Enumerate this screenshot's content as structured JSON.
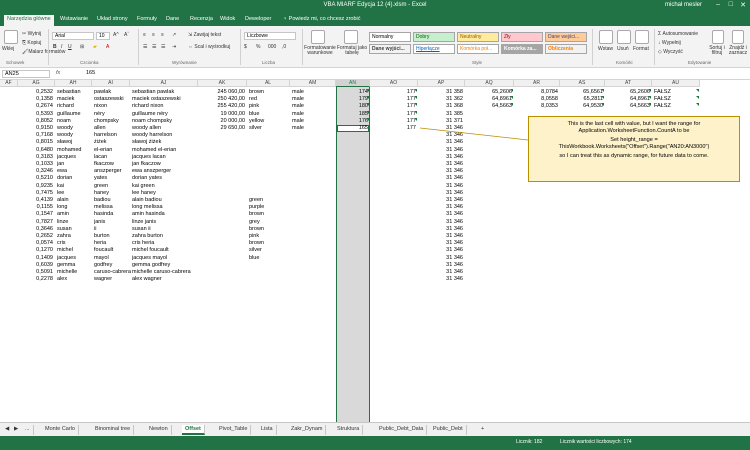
{
  "window": {
    "title": "VBA MIARF Edycja 12 (4).xlsm - Excel",
    "user": "michał mesler"
  },
  "ribbon_tabs": [
    "Narzędzia główne",
    "Wstawianie",
    "Układ strony",
    "Formuły",
    "Dane",
    "Recenzja",
    "Widok",
    "Deweloper"
  ],
  "tell_me": "Powiedz mi, co chcesz zrobić",
  "clipboard": {
    "cut": "Wytnij",
    "copy": "Kopiuj",
    "painter": "Malarz formatów",
    "paste": "Wklej",
    "group": "Schowek"
  },
  "font": {
    "name": "Arial",
    "size": "10",
    "group": "Czcionka"
  },
  "alignment": {
    "wrap": "Zawijaj tekst",
    "merge": "Scal i wyśrodkuj",
    "group": "Wyrównanie"
  },
  "number": {
    "format": "Liczbowe",
    "group": "Liczba"
  },
  "cond_format": "Formatowanie warunkowe",
  "format_table": "Formatuj jako tabelę",
  "styles": {
    "normal": "Normalny",
    "good": "Dobry",
    "neutral": "Neutralny",
    "bad": "Zły",
    "input": "Dane wejści...",
    "hyperlink": "Hiperłącze",
    "linked": "Komórka poł...",
    "check": "Komórka za...",
    "calculation": "Obliczenia",
    "output": "Dane wyjści...",
    "group": "Style"
  },
  "cells": {
    "insert": "Wstaw",
    "delete": "Usuń",
    "format": "Format",
    "group": "Komórki"
  },
  "editing": {
    "autosum": "Autosumowanie",
    "fill": "Wypełnij",
    "clear": "Wyczyść",
    "sort": "Sortuj i filtruj",
    "find": "Znajdź i zaznacz",
    "group": "Edytowanie"
  },
  "formula_bar": {
    "name_box": "AN25",
    "fx": "fx",
    "value": "165"
  },
  "columns": [
    "AF",
    "AG",
    "AH",
    "AI",
    "AJ",
    "AK",
    "AL",
    "AM",
    "AN",
    "AO",
    "AP",
    "AQ",
    "AR",
    "AS",
    "AT",
    "AU"
  ],
  "rows": [
    {
      "ag": "0,2532",
      "ah": "sebastian",
      "ai": "pawlak",
      "aj": "sebastian pawlak",
      "ak": "245 060,00",
      "al": "brown",
      "am": "male",
      "an": "174",
      "ao": "177",
      "ap": "31 358",
      "aq": "65,2606",
      "ar": "8,0784",
      "as": "65,6561",
      "at": "65,2606",
      "au": "FAŁSZ"
    },
    {
      "ag": "0,1358",
      "ah": "maciek",
      "ai": "ostaszewski",
      "aj": "maciek ostaszewski",
      "ak": "250 420,00",
      "al": "red",
      "am": "male",
      "an": "179",
      "ao": "177",
      "ap": "31 362",
      "aq": "64,8961",
      "ar": "8,0558",
      "as": "65,2811",
      "at": "64,8961",
      "au": "FAŁSZ"
    },
    {
      "ag": "0,2674",
      "ah": "richard",
      "ai": "nixon",
      "aj": "richard nixon",
      "ak": "255 420,00",
      "al": "pink",
      "am": "male",
      "an": "180",
      "ao": "177",
      "ap": "31 368",
      "aq": "64,5663",
      "ar": "8,0353",
      "as": "64,9530",
      "at": "64,5663",
      "au": "FAŁSZ"
    },
    {
      "ag": "0,5393",
      "ah": "guillaume",
      "ai": "néry",
      "aj": "guillaume néry",
      "ak": "19 000,00",
      "al": "blue",
      "am": "male",
      "an": "185",
      "ao": "177",
      "ap": "31 385",
      "aq": "",
      "ar": "",
      "as": "",
      "at": "",
      "au": ""
    },
    {
      "ag": "0,8052",
      "ah": "noam",
      "ai": "chompsky",
      "aj": "noam chompsky",
      "ak": "20 000,00",
      "al": "yellow",
      "am": "male",
      "an": "176",
      "ao": "177",
      "ap": "31 371",
      "aq": "",
      "ar": "",
      "as": "",
      "at": "",
      "au": ""
    },
    {
      "ag": "0,9150",
      "ah": "woody",
      "ai": "allen",
      "aj": "woody allen",
      "ak": "29 650,00",
      "al": "silver",
      "am": "male",
      "an": "165",
      "ao": "177",
      "ap": "31 346",
      "aq": "",
      "ar": "",
      "as": "",
      "at": "",
      "au": ""
    },
    {
      "ag": "0,7168",
      "ah": "woody",
      "ai": "harrelson",
      "aj": "woody harrelson",
      "ak": "",
      "al": "",
      "am": "",
      "an": "",
      "ao": "",
      "ap": "31 346",
      "aq": "",
      "ar": "",
      "as": "",
      "at": "",
      "au": ""
    },
    {
      "ag": "0,8015",
      "ah": "sławoj",
      "ai": "żiżek",
      "aj": "sławoj żiżek",
      "ak": "",
      "al": "",
      "am": "",
      "an": "",
      "ao": "",
      "ap": "31 346",
      "aq": "",
      "ar": "",
      "as": "",
      "at": "",
      "au": ""
    },
    {
      "ag": "0,6480",
      "ah": "mohamed",
      "ai": "el-erian",
      "aj": "mohamed el-erian",
      "ak": "",
      "al": "",
      "am": "",
      "an": "",
      "ao": "",
      "ap": "31 346",
      "aq": "",
      "ar": "",
      "as": "",
      "at": "",
      "au": ""
    },
    {
      "ag": "0,3183",
      "ah": "jacques",
      "ai": "lacan",
      "aj": "jacques lacan",
      "ak": "",
      "al": "",
      "am": "",
      "an": "",
      "ao": "",
      "ap": "31 346",
      "aq": "",
      "ar": "",
      "as": "",
      "at": "",
      "au": ""
    },
    {
      "ag": "0,1033",
      "ah": "jan",
      "ai": "fkaczow",
      "aj": "jan fkaczow",
      "ak": "",
      "al": "",
      "am": "",
      "an": "",
      "ao": "",
      "ap": "31 346",
      "aq": "",
      "ar": "",
      "as": "",
      "at": "",
      "au": ""
    },
    {
      "ag": "0,3246",
      "ah": "ewa",
      "ai": "anszperger",
      "aj": "ewa anszperger",
      "ak": "",
      "al": "",
      "am": "",
      "an": "",
      "ao": "",
      "ap": "31 346",
      "aq": "",
      "ar": "",
      "as": "",
      "at": "",
      "au": ""
    },
    {
      "ag": "0,5210",
      "ah": "dorian",
      "ai": "yates",
      "aj": "dorian yates",
      "ak": "",
      "al": "",
      "am": "",
      "an": "",
      "ao": "",
      "ap": "31 346",
      "aq": "",
      "ar": "",
      "as": "",
      "at": "",
      "au": ""
    },
    {
      "ag": "0,9235",
      "ah": "kai",
      "ai": "green",
      "aj": "kai green",
      "ak": "",
      "al": "",
      "am": "",
      "an": "",
      "ao": "",
      "ap": "31 346",
      "aq": "",
      "ar": "",
      "as": "",
      "at": "",
      "au": ""
    },
    {
      "ag": "0,7475",
      "ah": "lee",
      "ai": "haney",
      "aj": "lee haney",
      "ak": "",
      "al": "",
      "am": "",
      "an": "",
      "ao": "",
      "ap": "31 346",
      "aq": "",
      "ar": "",
      "as": "",
      "at": "",
      "au": ""
    },
    {
      "ag": "0,4139",
      "ah": "alain",
      "ai": "badiou",
      "aj": "alain badiou",
      "ak": "",
      "al": "green",
      "am": "",
      "an": "",
      "ao": "",
      "ap": "31 346",
      "aq": "",
      "ar": "",
      "as": "",
      "at": "",
      "au": ""
    },
    {
      "ag": "0,1155",
      "ah": "long",
      "ai": "melissa",
      "aj": "long melissa",
      "ak": "",
      "al": "purple",
      "am": "",
      "an": "",
      "ao": "",
      "ap": "31 346",
      "aq": "",
      "ar": "",
      "as": "",
      "at": "",
      "au": ""
    },
    {
      "ag": "0,1547",
      "ah": "amin",
      "ai": "hasinda",
      "aj": "amin hasinda",
      "ak": "",
      "al": "brown",
      "am": "",
      "an": "",
      "ao": "",
      "ap": "31 346",
      "aq": "",
      "ar": "",
      "as": "",
      "at": "",
      "au": ""
    },
    {
      "ag": "0,7827",
      "ah": "linze",
      "ai": "janis",
      "aj": "linze janis",
      "ak": "",
      "al": "grey",
      "am": "",
      "an": "",
      "ao": "",
      "ap": "31 346",
      "aq": "",
      "ar": "",
      "as": "",
      "at": "",
      "au": ""
    },
    {
      "ag": "0,3646",
      "ah": "susan",
      "ai": "ii",
      "aj": "susan ii",
      "ak": "",
      "al": "brown",
      "am": "",
      "an": "",
      "ao": "",
      "ap": "31 346",
      "aq": "",
      "ar": "",
      "as": "",
      "at": "",
      "au": ""
    },
    {
      "ag": "0,2652",
      "ah": "zahra",
      "ai": "burton",
      "aj": "zahra burton",
      "ak": "",
      "al": "pink",
      "am": "",
      "an": "",
      "ao": "",
      "ap": "31 346",
      "aq": "",
      "ar": "",
      "as": "",
      "at": "",
      "au": ""
    },
    {
      "ag": "0,0574",
      "ah": "cris",
      "ai": "heria",
      "aj": "cris heria",
      "ak": "",
      "al": "brown",
      "am": "",
      "an": "",
      "ao": "",
      "ap": "31 346",
      "aq": "",
      "ar": "",
      "as": "",
      "at": "",
      "au": ""
    },
    {
      "ag": "0,1270",
      "ah": "michel",
      "ai": "foucault",
      "aj": "michel foucault",
      "ak": "",
      "al": "silver",
      "am": "",
      "an": "",
      "ao": "",
      "ap": "31 346",
      "aq": "",
      "ar": "",
      "as": "",
      "at": "",
      "au": ""
    },
    {
      "ag": "0,1409",
      "ah": "jacques",
      "ai": "mayol",
      "aj": "jacques mayol",
      "ak": "",
      "al": "blue",
      "am": "",
      "an": "",
      "ao": "",
      "ap": "31 346",
      "aq": "",
      "ar": "",
      "as": "",
      "at": "",
      "au": ""
    },
    {
      "ag": "0,6039",
      "ah": "gemma",
      "ai": "godfrey",
      "aj": "gemma godfrey",
      "ak": "",
      "al": "",
      "am": "",
      "an": "",
      "ao": "",
      "ap": "31 346",
      "aq": "",
      "ar": "",
      "as": "",
      "at": "",
      "au": ""
    },
    {
      "ag": "0,5091",
      "ah": "michelle",
      "ai": "caruso-cabrera",
      "aj": "michelle caruso-cabrera",
      "ak": "",
      "al": "",
      "am": "",
      "an": "",
      "ao": "",
      "ap": "31 346",
      "aq": "",
      "ar": "",
      "as": "",
      "at": "",
      "au": ""
    },
    {
      "ag": "0,2278",
      "ah": "alex",
      "ai": "wagner",
      "aj": "alex wagner",
      "ak": "",
      "al": "",
      "am": "",
      "an": "",
      "ao": "",
      "ap": "31 346",
      "aq": "",
      "ar": "",
      "as": "",
      "at": "",
      "au": ""
    }
  ],
  "callout": {
    "line1": "This is the last cell with value, but I want the range for Application.WorksheetFunction.CountA to be",
    "line2": "Set height_range = ThisWorkbook.Worksheets(\"Offset\").Range(\"AN20:AN3000\")",
    "line3": "so I can treat this as dynamic range, for future data to come."
  },
  "sheet_tabs": [
    "...",
    "Monte Carlo",
    "Binominal tree",
    "Newton",
    "Offset",
    "Pivot_Table",
    "Lista",
    "Zakr_Dynam",
    "Struktura",
    "Public_Debt_Data",
    "Public_Debt"
  ],
  "active_tab": "Offset",
  "add_sheet": "+",
  "status": {
    "count": "Licznik: 182",
    "count_numeric": "Licznik wartości liczbowych: 174"
  },
  "accent": "#217346"
}
